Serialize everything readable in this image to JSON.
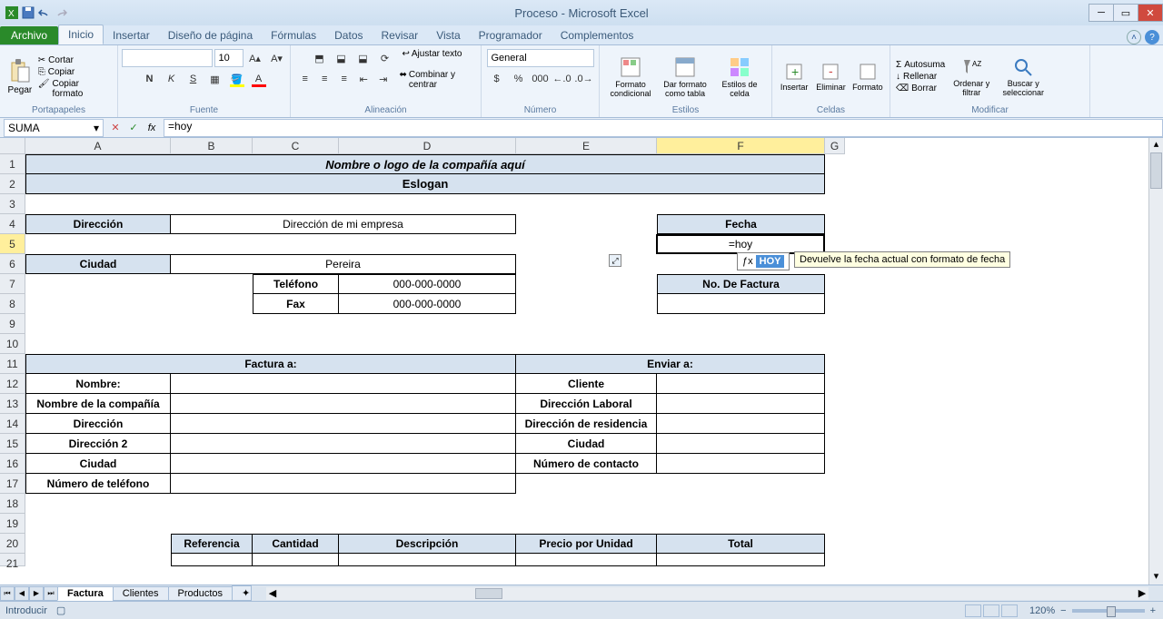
{
  "title": "Proceso - Microsoft Excel",
  "file_tab": "Archivo",
  "tabs": [
    "Inicio",
    "Insertar",
    "Diseño de página",
    "Fórmulas",
    "Datos",
    "Revisar",
    "Vista",
    "Programador",
    "Complementos"
  ],
  "ribbon": {
    "clipboard": {
      "label": "Portapapeles",
      "paste": "Pegar",
      "cut": "Cortar",
      "copy": "Copiar",
      "format": "Copiar formato"
    },
    "font": {
      "label": "Fuente",
      "size": "10"
    },
    "align": {
      "label": "Alineación",
      "wrap": "Ajustar texto",
      "merge": "Combinar y centrar"
    },
    "number": {
      "label": "Número",
      "format": "General"
    },
    "styles": {
      "label": "Estilos",
      "cond": "Formato condicional",
      "table": "Dar formato como tabla",
      "cell": "Estilos de celda"
    },
    "cells": {
      "label": "Celdas",
      "insert": "Insertar",
      "delete": "Eliminar",
      "format": "Formato"
    },
    "edit": {
      "label": "Modificar",
      "sum": "Autosuma",
      "fill": "Rellenar",
      "clear": "Borrar",
      "sort": "Ordenar y filtrar",
      "find": "Buscar y seleccionar"
    }
  },
  "name_box": "SUMA",
  "formula": "=hoy",
  "tooltip_fn": "HOY",
  "tooltip_desc": "Devuelve la fecha actual con formato de fecha",
  "columns": [
    "A",
    "B",
    "C",
    "D",
    "E",
    "F",
    "G"
  ],
  "rows": [
    "1",
    "2",
    "3",
    "4",
    "5",
    "6",
    "7",
    "8",
    "9",
    "10",
    "11",
    "12",
    "13",
    "14",
    "15",
    "16",
    "17",
    "18",
    "19",
    "20",
    "21"
  ],
  "cells": {
    "company_header": "Nombre o logo de la compañía aquí",
    "slogan": "Eslogan",
    "direccion_lbl": "Dirección",
    "direccion_val": "Dirección de mi empresa",
    "ciudad_lbl": "Ciudad",
    "ciudad_val": "Pereira",
    "telefono_lbl": "Teléfono",
    "telefono_val": "000-000-0000",
    "fax_lbl": "Fax",
    "fax_val": "000-000-0000",
    "fecha_lbl": "Fecha",
    "fecha_val": "=hoy",
    "factura_lbl": "No. De Factura",
    "factura_a": "Factura a:",
    "enviar_a": "Enviar a:",
    "nombre": "Nombre:",
    "nombre_comp": "Nombre de la compañía",
    "dir": "Dirección",
    "dir2": "Dirección 2",
    "ciudad2": "Ciudad",
    "tel": "Número de teléfono",
    "cliente": "Cliente",
    "dir_lab": "Dirección Laboral",
    "dir_res": "Dirección de residencia",
    "ciudad3": "Ciudad",
    "contacto": "Número de contacto",
    "ref": "Referencia",
    "cant": "Cantidad",
    "desc": "Descripción",
    "precio": "Precio por Unidad",
    "total": "Total"
  },
  "sheets": [
    "Factura",
    "Clientes",
    "Productos"
  ],
  "status": "Introducir",
  "zoom": "120%"
}
